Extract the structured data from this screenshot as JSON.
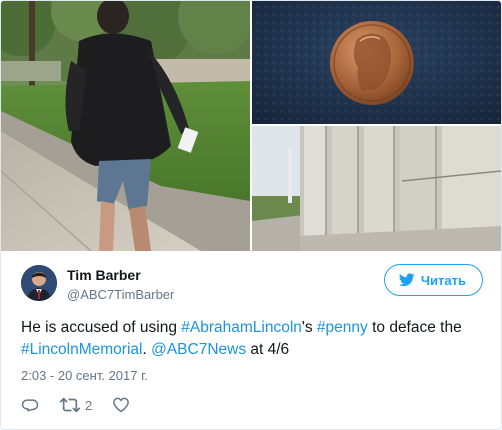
{
  "media": {
    "photos": [
      {
        "subject": "man-walking-photo"
      },
      {
        "subject": "penny-photo"
      },
      {
        "subject": "lincoln-memorial-columns-photo"
      }
    ]
  },
  "author": {
    "name": "Tim Barber",
    "handle": "@ABC7TimBarber"
  },
  "follow_button": {
    "label": "Читать",
    "icon": "twitter-bird-icon"
  },
  "tweet": {
    "text_before": "He is accused of using ",
    "hashtag_1": "#AbrahamLincoln",
    "text_mid_1": "'s ",
    "hashtag_2": "#penny",
    "text_mid_2": " to deface the ",
    "hashtag_3": "#LincolnMemorial",
    "text_mid_3": ". ",
    "mention_1": "@ABC7News",
    "text_after": " at 4/6"
  },
  "timestamp": "2:03 - 20 сент. 2017 г.",
  "actions": {
    "reply_icon": "reply-icon",
    "retweet_icon": "retweet-icon",
    "retweet_count": "2",
    "like_icon": "heart-icon"
  },
  "colors": {
    "link": "#1b95e0",
    "accent": "#1da1f2",
    "secondary_text": "#657786"
  }
}
